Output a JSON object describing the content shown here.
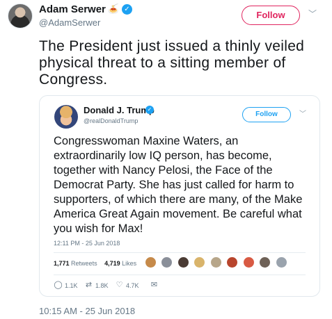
{
  "tweet": {
    "author_name": "Adam Serwer",
    "author_handle": "@AdamSerwer",
    "name_emoji": "🍝",
    "follow_label": "Follow",
    "text": "The President just issued a thinly veiled physical threat to a sitting member of Congress.",
    "timestamp": "10:15 AM - 25 Jun 2018"
  },
  "quoted": {
    "author_name": "Donald J. Trump",
    "author_handle": "@realDonaldTrump",
    "follow_label": "Follow",
    "text": "Congresswoman Maxine Waters, an extraordinarily low IQ person, has become, together with Nancy Pelosi, the Face of the Democrat Party. She has just called for harm to supporters, of which there are many, of the Make America Great Again movement. Be careful what you wish for Max!",
    "timestamp": "12:11 PM - 25 Jun 2018",
    "retweets_count": "1,771",
    "retweets_label": "Retweets",
    "likes_count": "4,719",
    "likes_label": "Likes",
    "actions": {
      "reply_count": "1.1K",
      "retweet_count": "1.8K",
      "like_count": "4.7K"
    }
  },
  "colors": {
    "follow_outer": "#e0245e",
    "follow_inner": "#1da1f2",
    "verified": "#1da1f2",
    "secondary_text": "#657786"
  }
}
